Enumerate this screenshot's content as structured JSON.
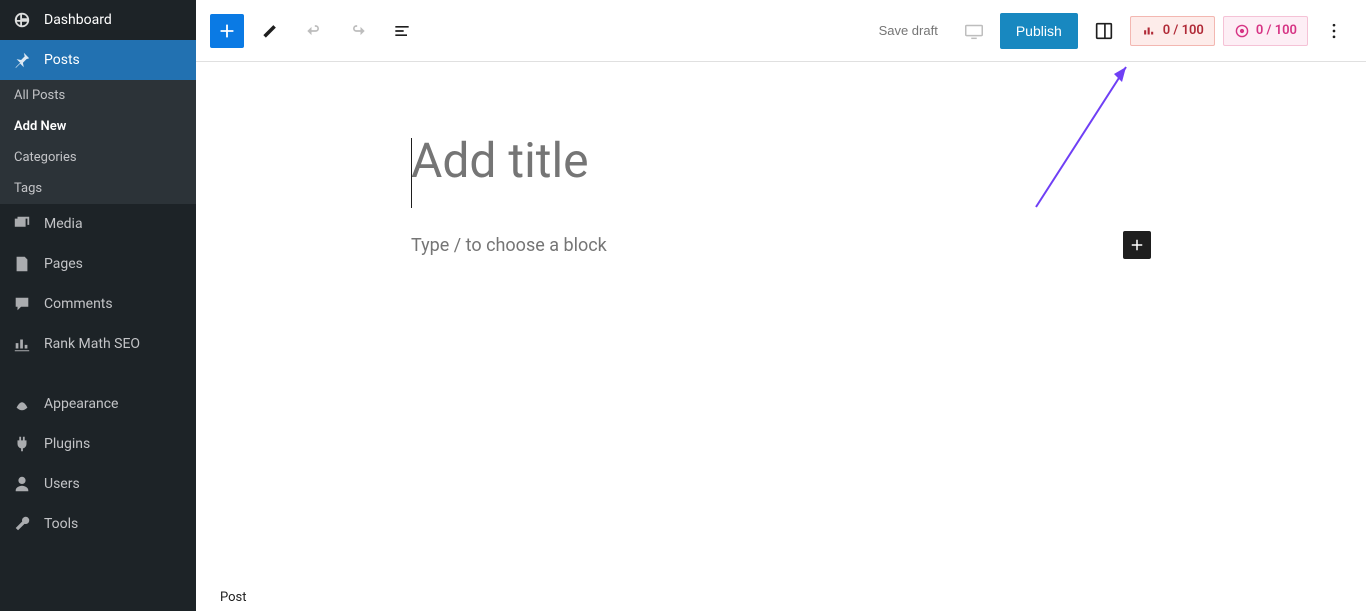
{
  "sidebar": {
    "dashboard": "Dashboard",
    "posts": "Posts",
    "submenu": {
      "all": "All Posts",
      "add": "Add New",
      "categories": "Categories",
      "tags": "Tags"
    },
    "media": "Media",
    "pages": "Pages",
    "comments": "Comments",
    "rankmath": "Rank Math SEO",
    "appearance": "Appearance",
    "plugins": "Plugins",
    "users": "Users",
    "tools": "Tools"
  },
  "header": {
    "save_draft": "Save draft",
    "publish": "Publish",
    "score_ai": "0 / 100",
    "score_rm": "0 / 100"
  },
  "editor": {
    "title_placeholder": "Add title",
    "block_placeholder": "Type / to choose a block",
    "footer_tab": "Post"
  }
}
